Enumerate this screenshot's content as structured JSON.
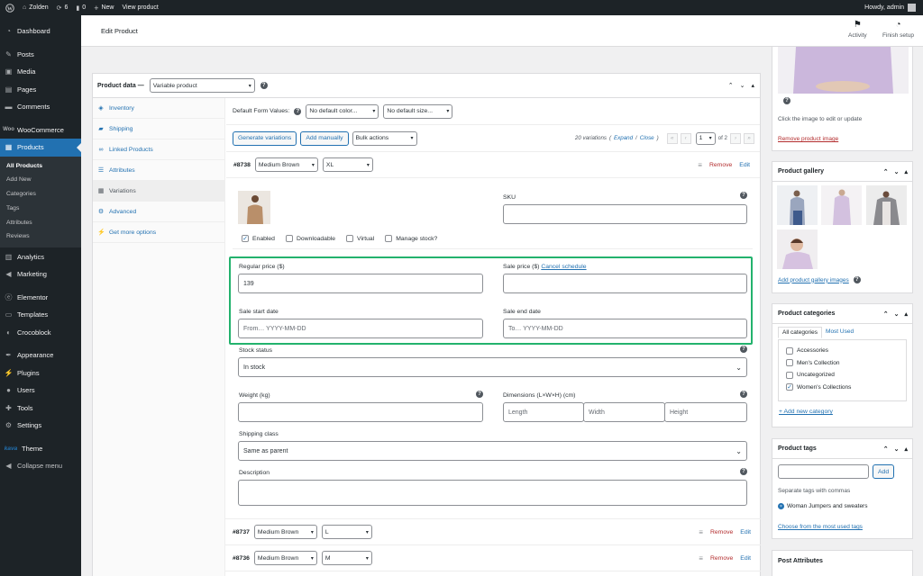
{
  "adminbar": {
    "site_name": "Zolden",
    "updates_count": "6",
    "comments_count": "0",
    "new_label": "New",
    "view_product": "View product",
    "howdy": "Howdy, admin"
  },
  "sidebar": {
    "items": [
      {
        "label": "Dashboard",
        "icon": "dashboard-icon"
      },
      {
        "label": "Posts",
        "icon": "pin-icon"
      },
      {
        "label": "Media",
        "icon": "media-icon"
      },
      {
        "label": "Pages",
        "icon": "pages-icon"
      },
      {
        "label": "Comments",
        "icon": "comments-icon"
      },
      {
        "label": "WooCommerce",
        "icon": "woo-icon"
      },
      {
        "label": "Products",
        "icon": "products-icon"
      },
      {
        "label": "Analytics",
        "icon": "analytics-icon"
      },
      {
        "label": "Marketing",
        "icon": "marketing-icon"
      },
      {
        "label": "Elementor",
        "icon": "elementor-icon"
      },
      {
        "label": "Templates",
        "icon": "templates-icon"
      },
      {
        "label": "Crocoblock",
        "icon": "crocoblock-icon"
      },
      {
        "label": "Appearance",
        "icon": "appearance-icon"
      },
      {
        "label": "Plugins",
        "icon": "plugins-icon"
      },
      {
        "label": "Users",
        "icon": "users-icon"
      },
      {
        "label": "Tools",
        "icon": "tools-icon"
      },
      {
        "label": "Settings",
        "icon": "settings-icon"
      },
      {
        "label": "Theme",
        "icon": "kava-icon"
      },
      {
        "label": "Collapse menu",
        "icon": "collapse-icon"
      }
    ],
    "kava_logo": "kava",
    "submenu": [
      "All Products",
      "Add New",
      "Categories",
      "Tags",
      "Attributes",
      "Reviews"
    ]
  },
  "header": {
    "title": "Edit Product",
    "activity": "Activity",
    "finish_setup": "Finish setup"
  },
  "product_data": {
    "label": "Product data —",
    "type": "Variable product",
    "tabs": [
      "Inventory",
      "Shipping",
      "Linked Products",
      "Attributes",
      "Variations",
      "Advanced",
      "Get more options"
    ],
    "default_form_values_label": "Default Form Values:",
    "default_color": "No default color...",
    "default_size": "No default size...",
    "generate_variations": "Generate variations",
    "add_manually": "Add manually",
    "bulk_actions": "Bulk actions",
    "variations_count": "20 variations",
    "expand": "Expand",
    "close": "Close",
    "expand_close_open": "(",
    "expand_close_sep": " / ",
    "expand_close_end": ")",
    "page_current": "1",
    "page_of": "of 2",
    "first_btn": "«",
    "prev_btn": "‹",
    "next_btn": "›",
    "last_btn": "»"
  },
  "variation_main": {
    "id": "#8738",
    "color": "Medium Brown",
    "size": "XL",
    "remove": "Remove",
    "edit": "Edit",
    "sku_label": "SKU",
    "enabled": "Enabled",
    "downloadable": "Downloadable",
    "virtual": "Virtual",
    "manage_stock": "Manage stock?",
    "regular_price_label": "Regular price ($)",
    "regular_price": "139",
    "sale_price_label": "Sale price ($)",
    "cancel_schedule": "Cancel schedule",
    "sale_start_label": "Sale start date",
    "sale_start_placeholder": "From… YYYY-MM-DD",
    "sale_end_label": "Sale end date",
    "sale_end_placeholder": "To…  YYYY-MM-DD",
    "stock_status_label": "Stock status",
    "stock_status": "In stock",
    "weight_label": "Weight (kg)",
    "dimensions_label": "Dimensions (L×W×H) (cm)",
    "length_ph": "Length",
    "width_ph": "Width",
    "height_ph": "Height",
    "shipping_class_label": "Shipping class",
    "shipping_class": "Same as parent",
    "description_label": "Description"
  },
  "variation_rows": [
    {
      "id": "#8737",
      "color": "Medium Brown",
      "size": "L",
      "remove": "Remove",
      "edit": "Edit"
    },
    {
      "id": "#8736",
      "color": "Medium Brown",
      "size": "M",
      "remove": "Remove",
      "edit": "Edit"
    }
  ],
  "product_image": {
    "hint": "Click the image to edit or update",
    "remove": "Remove product image"
  },
  "product_gallery": {
    "title": "Product gallery",
    "add": "Add product gallery images"
  },
  "product_categories": {
    "title": "Product categories",
    "tab_all": "All categories",
    "tab_most_used": "Most Used",
    "items": [
      {
        "label": "Accessories",
        "checked": false
      },
      {
        "label": "Men's Collection",
        "checked": false
      },
      {
        "label": "Uncategorized",
        "checked": false
      },
      {
        "label": "Women's Collections",
        "checked": true
      }
    ],
    "add_new": "+ Add new category"
  },
  "product_tags": {
    "title": "Product tags",
    "add_button": "Add",
    "hint": "Separate tags with commas",
    "tag": "Woman Jumpers and sweaters",
    "choose": "Choose from the most used tags"
  },
  "post_attributes": {
    "title": "Post Attributes"
  },
  "colors": {
    "accent": "#2271b1",
    "highlight": "#23b26d",
    "admin_dark": "#1d2327",
    "remove_red": "#b32d2e"
  }
}
